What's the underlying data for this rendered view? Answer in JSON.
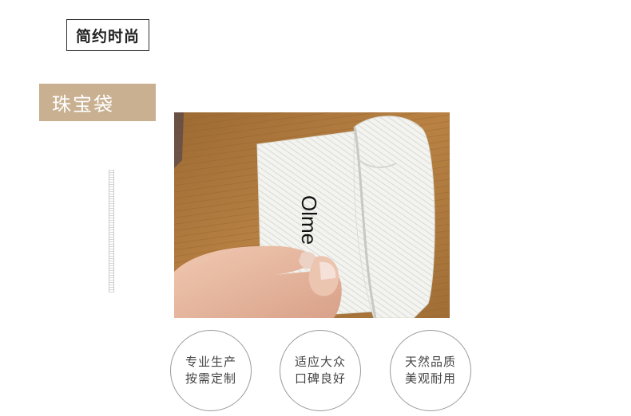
{
  "header": {
    "tag_label": "简约时尚"
  },
  "section": {
    "title": "珠宝袋"
  },
  "photo": {
    "bag_text": "Olme"
  },
  "features": [
    {
      "line1": "专业生产",
      "line2": "按需定制"
    },
    {
      "line1": "适应大众",
      "line2": "口碑良好"
    },
    {
      "line1": "天然品质",
      "line2": "美观耐用"
    }
  ],
  "colors": {
    "section_bg": "#c8b090",
    "tag_border": "#333333",
    "circle_border": "#9a9a9a",
    "wood": "#b07a3c"
  }
}
